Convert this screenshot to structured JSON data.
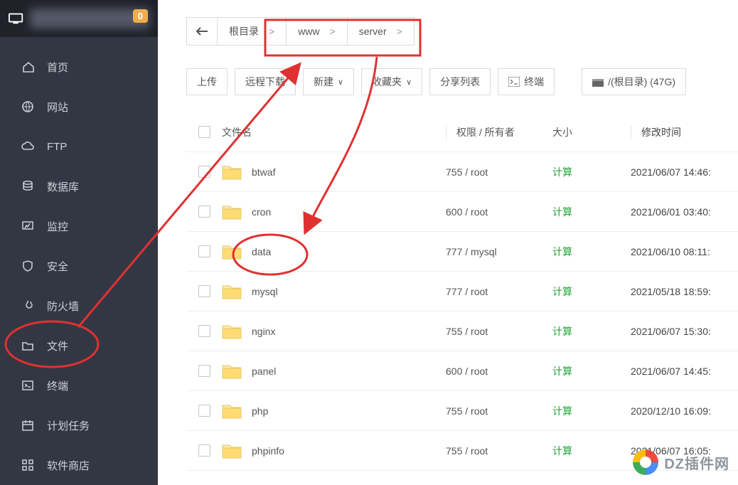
{
  "header": {
    "badge": "0"
  },
  "sidebar": {
    "items": [
      {
        "label": "首页",
        "icon": "home"
      },
      {
        "label": "网站",
        "icon": "globe"
      },
      {
        "label": "FTP",
        "icon": "cloud"
      },
      {
        "label": "数据库",
        "icon": "db"
      },
      {
        "label": "监控",
        "icon": "monitor"
      },
      {
        "label": "安全",
        "icon": "shield"
      },
      {
        "label": "防火墙",
        "icon": "fire"
      },
      {
        "label": "文件",
        "icon": "folder"
      },
      {
        "label": "终端",
        "icon": "terminal"
      },
      {
        "label": "计划任务",
        "icon": "calendar"
      },
      {
        "label": "软件商店",
        "icon": "grid"
      }
    ]
  },
  "breadcrumb": {
    "root": "根目录",
    "parts": [
      "www",
      "server"
    ]
  },
  "toolbar": {
    "upload": "上传",
    "remote": "远程下载",
    "new_label": "新建",
    "fav": "收藏夹",
    "share": "分享列表",
    "terminal": "终端",
    "disk": "/(根目录) (47G)"
  },
  "columns": {
    "name": "文件名",
    "perm": "权限 / 所有者",
    "size": "大小",
    "date": "修改时间"
  },
  "files": [
    {
      "name": "btwaf",
      "perm": "755 / root",
      "size": "计算",
      "date": "2021/06/07 14:46:"
    },
    {
      "name": "cron",
      "perm": "600 / root",
      "size": "计算",
      "date": "2021/06/01 03:40:"
    },
    {
      "name": "data",
      "perm": "777 / mysql",
      "size": "计算",
      "date": "2021/06/10 08:11:"
    },
    {
      "name": "mysql",
      "perm": "777 / root",
      "size": "计算",
      "date": "2021/05/18 18:59:"
    },
    {
      "name": "nginx",
      "perm": "755 / root",
      "size": "计算",
      "date": "2021/06/07 15:30:"
    },
    {
      "name": "panel",
      "perm": "600 / root",
      "size": "计算",
      "date": "2021/06/07 14:45:"
    },
    {
      "name": "php",
      "perm": "755 / root",
      "size": "计算",
      "date": "2020/12/10 16:09:"
    },
    {
      "name": "phpinfo",
      "perm": "755 / root",
      "size": "计算",
      "date": "2021/06/07 16:05:"
    }
  ],
  "watermark": "DZ插件网",
  "annotations": {
    "highlight_nav": "文件",
    "highlight_folder": "data",
    "highlight_breadcrumb": [
      "www",
      "server"
    ]
  }
}
